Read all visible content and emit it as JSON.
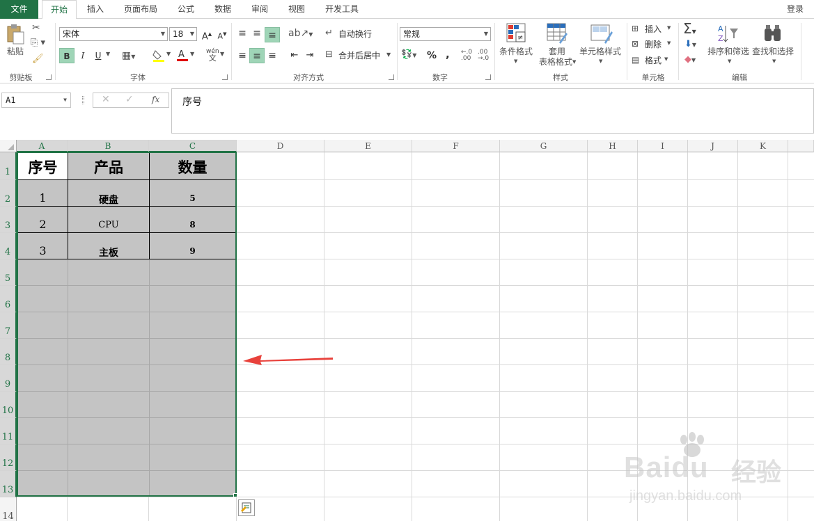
{
  "tabs": [
    "文件",
    "开始",
    "插入",
    "页面布局",
    "公式",
    "数据",
    "审阅",
    "视图",
    "开发工具"
  ],
  "login": "登录",
  "ribbon": {
    "clipboard": {
      "paste": "粘贴",
      "group": "剪贴板"
    },
    "font": {
      "name": "宋体",
      "size": "18",
      "bold": "B",
      "italic": "I",
      "underline": "U",
      "group": "字体"
    },
    "align": {
      "wrap": "自动换行",
      "merge": "合并后居中",
      "group": "对齐方式"
    },
    "number": {
      "format": "常规",
      "percent": "%",
      "comma": ",",
      "group": "数字"
    },
    "styles": {
      "cond": "条件格式",
      "table1": "套用",
      "table2": "表格格式",
      "cell": "单元格样式",
      "group": "样式"
    },
    "cells": {
      "insert": "插入",
      "delete": "删除",
      "format": "格式",
      "group": "单元格"
    },
    "edit": {
      "sort": "排序和筛选",
      "find": "查找和选择",
      "group": "编辑"
    }
  },
  "formula_bar": {
    "name_box": "A1",
    "fx": "fx",
    "content": "序号"
  },
  "columns": [
    "A",
    "B",
    "C",
    "D",
    "E",
    "F",
    "G",
    "H",
    "I",
    "J",
    "K"
  ],
  "rows": [
    "1",
    "2",
    "3",
    "4",
    "5",
    "6",
    "7",
    "8",
    "9",
    "10",
    "11",
    "12",
    "13",
    "14"
  ],
  "table": {
    "headers": [
      "序号",
      "产品",
      "数量"
    ],
    "rows": [
      [
        "1",
        "硬盘",
        "5"
      ],
      [
        "2",
        "CPU",
        "8"
      ],
      [
        "3",
        "主板",
        "9"
      ]
    ]
  },
  "watermark": {
    "brand": "Bai",
    "brand2": "du",
    "jy": "经验",
    "url": "jingyan.baidu.com"
  },
  "colors": {
    "excel_green": "#217346",
    "selection": "#c4c4c4",
    "arrow": "#e8413b"
  }
}
